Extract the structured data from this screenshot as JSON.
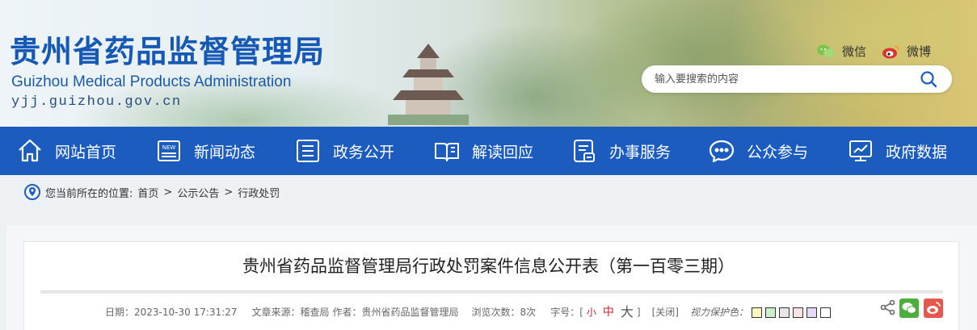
{
  "header": {
    "title_cn": "贵州省药品监督管理局",
    "title_en": "Guizhou Medical Products Administration",
    "url": "yjj.guizhou.gov.cn",
    "social": [
      {
        "label": "微信",
        "icon": "wechat-icon",
        "color": "#7cc44a"
      },
      {
        "label": "微博",
        "icon": "weibo-icon",
        "color": "#d9362f"
      }
    ],
    "search": {
      "placeholder": "输入要搜索的内容",
      "icon": "search-icon"
    }
  },
  "nav": {
    "items": [
      {
        "label": "网站首页",
        "icon": "home-icon"
      },
      {
        "label": "新闻动态",
        "icon": "news-icon"
      },
      {
        "label": "政务公开",
        "icon": "document-list-icon"
      },
      {
        "label": "解读回应",
        "icon": "open-book-icon"
      },
      {
        "label": "办事服务",
        "icon": "service-form-icon"
      },
      {
        "label": "公众参与",
        "icon": "chat-bubble-icon"
      },
      {
        "label": "政府数据",
        "icon": "data-chart-icon"
      }
    ],
    "color": "#1c5cbf"
  },
  "breadcrumb": {
    "prefix": "您当前所在的位置:",
    "items": [
      "首页",
      "公示公告",
      "行政处罚"
    ],
    "separator": ">"
  },
  "article": {
    "title": "贵州省药品监督管理局行政处罚案件信息公开表（第一百零三期）",
    "date_label": "日期：",
    "date": "2023-10-30 17:31:27",
    "source_label": "文章来源：",
    "source": "稽查局",
    "author_label": "作者：",
    "author": "贵州省药品监督管理局",
    "views_label": "浏览次数：",
    "views": "8次",
    "fontsize_label": "字号：[",
    "fontsize_small": "小",
    "fontsize_mid": "中",
    "fontsize_big": "大",
    "fontsize_close": "]",
    "close_label": "[关闭]",
    "eye_label": "视力保护色：",
    "eye_colors": [
      "#fff5c0",
      "#c9f0c9",
      "#e6e6e6",
      "#fde2e4",
      "#e6d9f7",
      "#ffffff"
    ]
  }
}
